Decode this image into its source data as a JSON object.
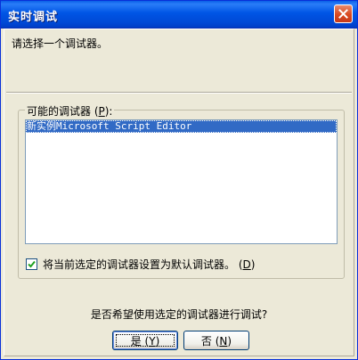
{
  "window": {
    "title": "实时调试"
  },
  "prompt": "请选择一个调试器。",
  "debuggers_group": {
    "label_text": "可能的调试器 (",
    "label_mnemonic": "P",
    "label_suffix": "):",
    "items": [
      {
        "label": "新实例Microsoft Script Editor",
        "selected": true
      }
    ]
  },
  "default_checkbox": {
    "checked": true,
    "label": "将当前选定的调试器设置为默认调试器。 (",
    "mnemonic": "D",
    "label_suffix": ")"
  },
  "question": "是否希望使用选定的调试器进行调试?",
  "buttons": {
    "yes_text": "是 (",
    "yes_mnemonic": "Y",
    "yes_suffix": ")",
    "no_text": "否 (",
    "no_mnemonic": "N",
    "no_suffix": ")"
  },
  "colors": {
    "title_bar": "#0055e5",
    "close_button": "#d9491f",
    "selection": "#316ac5",
    "dialog_face": "#ece9d8"
  },
  "icons": {
    "close": "close-icon",
    "check": "checkmark-icon"
  }
}
